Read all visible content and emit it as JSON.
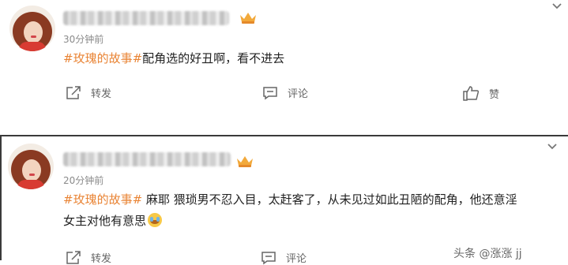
{
  "posts": [
    {
      "time": "30分钟前",
      "hashtag": "#玫瑰的故事#",
      "text": "配角选的好丑啊，看不进去",
      "line2": "",
      "actions": {
        "repost": "转发",
        "comment": "评论",
        "like": "赞"
      }
    },
    {
      "time": "20分钟前",
      "hashtag": "#玫瑰的故事#",
      "text": " 麻耶 猥琐男不忍入目，太赶客了，从未见过如此丑陋的配角，他还意淫",
      "line2": "女主对他有意思",
      "actions": {
        "repost": "转发",
        "comment": "评论"
      }
    }
  ],
  "watermark": "头条 @涨涨 jj"
}
